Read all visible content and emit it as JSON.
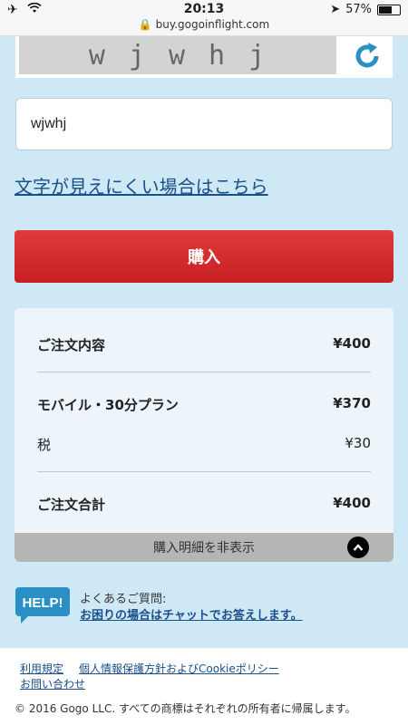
{
  "statusbar": {
    "time": "20:13",
    "url": "buy.gogoinflight.com",
    "battery": "57%"
  },
  "captcha": {
    "chars": [
      "w",
      "j",
      "w",
      "h",
      "j"
    ],
    "input_value": "wjwhj"
  },
  "hard_to_read_link": "文字が見えにくい場合はこちら",
  "buy_button": "購入",
  "summary": {
    "order_label": "ご注文内容",
    "order_value": "¥400",
    "plan_label": "モバイル・30分プラン",
    "plan_value": "¥370",
    "tax_label": "税",
    "tax_value": "¥30",
    "total_label": "ご注文合計",
    "total_value": "¥400",
    "toggle_label": "購入明細を非表示"
  },
  "help": {
    "icon_text": "HELP!",
    "label": "よくあるご質問:",
    "link": "お困りの場合はチャットでお答えします。"
  },
  "footer": {
    "terms": "利用規定",
    "privacy": "個人情報保護方針およびCookieポリシー",
    "contact": "お問い合わせ",
    "copyright": "© 2016 Gogo LLC. すべての商標はそれぞれの所有者に帰属します。"
  },
  "colors": {
    "background": "#cfe8f5",
    "buy_button": "#d62b2e",
    "link": "#1a4f8a",
    "help_icon": "#2a8fc4"
  }
}
